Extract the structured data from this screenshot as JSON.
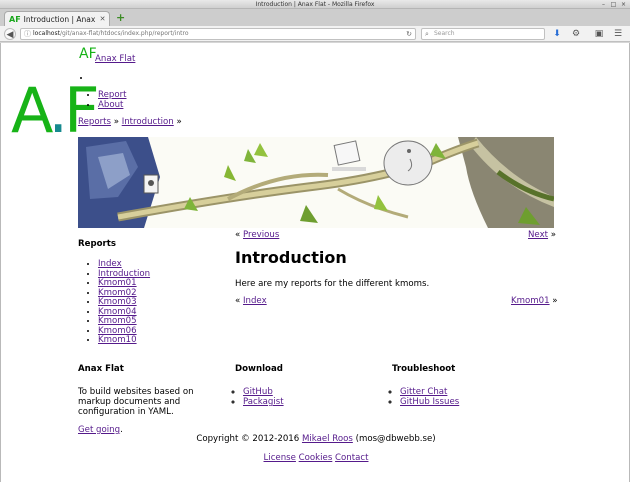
{
  "window": {
    "title": "Introduction | Anax Flat - Mozilla Firefox"
  },
  "tab": {
    "title": "Introduction | Anax Flat",
    "favicon_text": "AF"
  },
  "urlbar": {
    "host": "localhost",
    "path": "/git/anax-flat/htdocs/index.php/report/intro"
  },
  "searchbar": {
    "placeholder": "Search"
  },
  "site": {
    "logo_text": "AF",
    "title": "Anax Flat",
    "big_logo_a": "A",
    "big_logo_f": "F",
    "navbar": [
      "Report",
      "About"
    ]
  },
  "breadcrumb": {
    "items": [
      "Reports",
      "Introduction"
    ],
    "separator": "»"
  },
  "sidebar": {
    "heading": "Reports",
    "items": [
      "Index",
      "Introduction",
      "Kmom01",
      "Kmom02",
      "Kmom03",
      "Kmom04",
      "Kmom05",
      "Kmom06",
      "Kmom10"
    ]
  },
  "pager_top": {
    "prev": "Previous",
    "next": "Next"
  },
  "main": {
    "title": "Introduction",
    "text": "Here are my reports for the different kmoms."
  },
  "pager_bottom": {
    "prev": "Index",
    "next": "Kmom01"
  },
  "footer": {
    "col1": {
      "heading": "Anax Flat",
      "text": "To build websites based on markup documents and configuration in YAML.",
      "link": "Get going"
    },
    "col2": {
      "heading": "Download",
      "links": [
        "GitHub",
        "Packagist"
      ]
    },
    "col3": {
      "heading": "Troubleshoot",
      "links": [
        "Gitter Chat",
        "GitHub Issues"
      ]
    },
    "copyright_prefix": "Copyright © 2012-2016",
    "copyright_name": "Mikael Roos",
    "copyright_email": "(mos@dbwebb.se)",
    "links": [
      "License",
      "Cookies",
      "Contact"
    ]
  },
  "colors": {
    "logo_green": "#17b317",
    "logo_teal": "#168a8f",
    "link": "#551a8b"
  }
}
